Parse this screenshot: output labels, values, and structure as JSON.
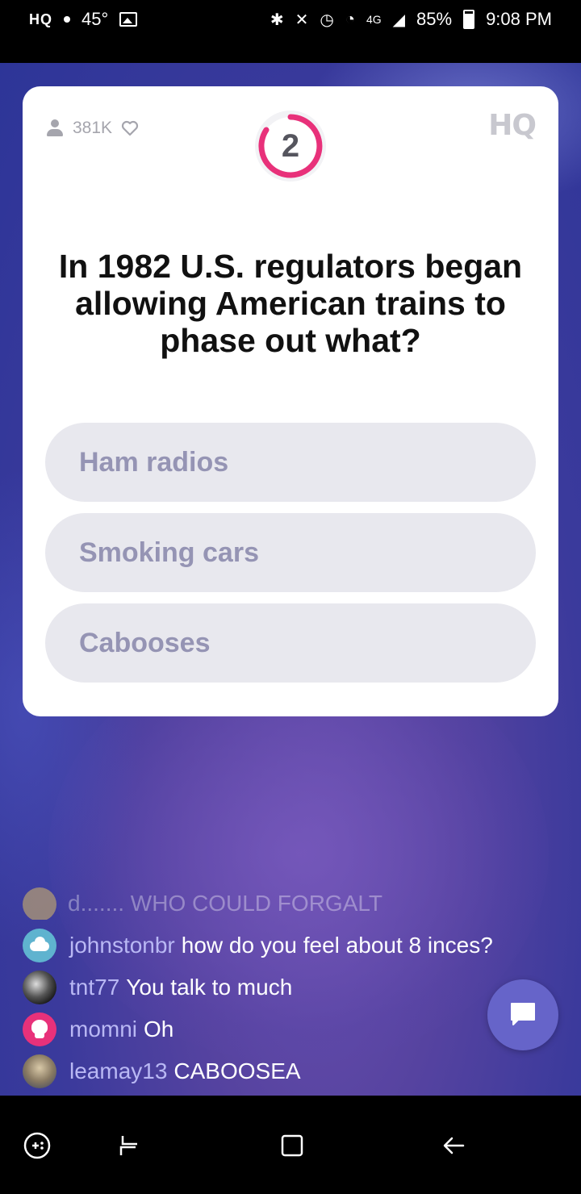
{
  "status_bar": {
    "app_label": "HQ",
    "temperature": "45°",
    "network": "4G",
    "battery": "85%",
    "time": "9:08 PM"
  },
  "card": {
    "viewer_count": "381K",
    "logo": "HQ",
    "timer_seconds": "2",
    "question": "In 1982 U.S. regulators began allowing American trains to phase out what?",
    "answers": [
      "Ham radios",
      "Smoking cars",
      "Cabooses"
    ]
  },
  "chat": {
    "faded_message": "d....... WHO COULD FORGALT",
    "messages": [
      {
        "user": "johnstonbr",
        "text": "how do you feel about 8 inces?",
        "avatar": "cloud-icon"
      },
      {
        "user": "tnt77",
        "text": "You talk to much",
        "avatar": "photo"
      },
      {
        "user": "momni",
        "text": "Oh",
        "avatar": "skull-icon"
      },
      {
        "user": "leamay13",
        "text": "CABOOSEA",
        "avatar": "photo"
      }
    ]
  },
  "colors": {
    "accent_pink": "#e8317a",
    "chat_user": "#b9b8f4",
    "answer_bg": "#e8e8ee",
    "answer_text": "#9594b4",
    "chat_button": "#6664c9"
  }
}
